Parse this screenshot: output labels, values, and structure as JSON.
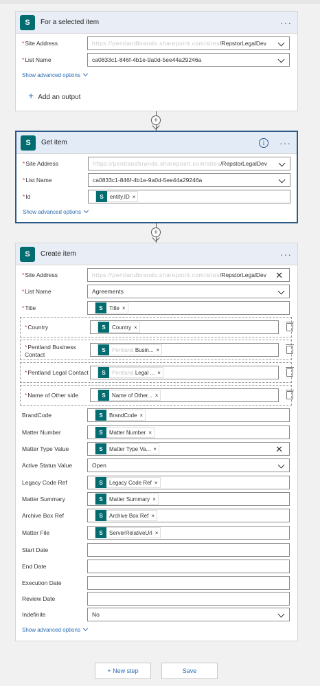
{
  "card1": {
    "title": "For a selected item",
    "site_label": "Site Address",
    "site_blur": "https://pentlandbrands.sharepoint.com/sites",
    "site_suffix": "/RepstorLegalDev",
    "list_label": "List Name",
    "list_value": "ca0833c1-846f-4b1e-9a0d-5ee44a29246a",
    "advanced": "Show advanced options",
    "add_output": "Add an output"
  },
  "card2": {
    "title": "Get item",
    "info": "i",
    "site_label": "Site Address",
    "site_blur": "https://pentlandbrands.sharepoint.com/sites",
    "site_suffix": "/RepstorLegalDev",
    "list_label": "List Name",
    "list_value": "ca0833c1-846f-4b1e-9a0d-5ee44a29246a",
    "id_label": "Id",
    "id_token": "entity.ID",
    "advanced": "Show advanced options"
  },
  "card3": {
    "title": "Create item",
    "site_label": "Site Address",
    "site_blur": "https://pentlandbrands.sharepoint.com/sites",
    "site_suffix": "/RepstorLegalDev",
    "list_label": "List Name",
    "list_value": "Agreements",
    "title_label": "Title",
    "title_token": "Title",
    "country_label": "Country",
    "country_token": "Country",
    "business_label_1": "Pentland Business",
    "business_label_2": "Contact",
    "business_token_blur": "Pentland",
    "business_token": "Busin...",
    "legal_label": "Pentland Legal Contact",
    "legal_token_blur": "Pentland",
    "legal_token": "Legal ...",
    "other_label": "Name of Other side",
    "other_token": "Name of Other...",
    "brandcode_label": "BrandCode",
    "brandcode_token": "BrandCode",
    "matter_number_label": "Matter Number",
    "matter_number_token": "Matter Number",
    "matter_type_label": "Matter Type Value",
    "matter_type_token": "Matter Type Va...",
    "active_label": "Active Status Value",
    "active_value": "Open",
    "legacy_label": "Legacy Code Ref",
    "legacy_token": "Legacy Code Ref",
    "summary_label": "Matter Summary",
    "summary_token": "Matter Summary",
    "archive_label": "Archive Box Ref",
    "archive_token": "Archive Box Ref",
    "file_label": "Matter File",
    "file_token": "ServerRelativeUrl",
    "start_label": "Start Date",
    "end_label": "End Date",
    "execution_label": "Execution Date",
    "review_label": "Review Date",
    "indefinite_label": "Indefinite",
    "indefinite_value": "No",
    "advanced": "Show advanced options"
  },
  "common": {
    "required": "*",
    "logo": "S",
    "more": "···",
    "token_x": "×",
    "clear_x": "✕",
    "connector_plus": "+",
    "add_plus": "+"
  },
  "footer": {
    "new_step": "+ New step",
    "save": "Save"
  },
  "colors": {
    "sharepoint": "#036c70",
    "accent": "#2b6cb0",
    "required": "#d13438"
  }
}
